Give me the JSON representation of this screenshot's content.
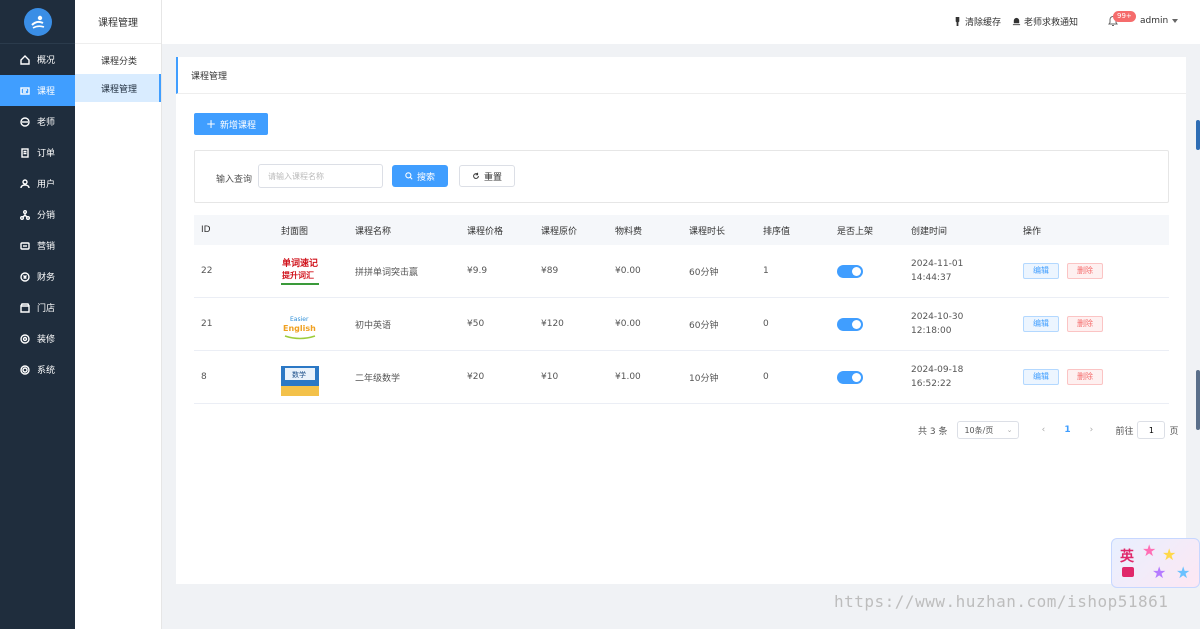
{
  "sidebar": {
    "items": [
      {
        "label": "概况",
        "icon": "home-icon"
      },
      {
        "label": "课程",
        "icon": "course-icon"
      },
      {
        "label": "老师",
        "icon": "teacher-icon"
      },
      {
        "label": "订单",
        "icon": "order-icon"
      },
      {
        "label": "用户",
        "icon": "user-icon"
      },
      {
        "label": "分销",
        "icon": "distribution-icon"
      },
      {
        "label": "营销",
        "icon": "marketing-icon"
      },
      {
        "label": "财务",
        "icon": "finance-icon"
      },
      {
        "label": "门店",
        "icon": "store-icon"
      },
      {
        "label": "装修",
        "icon": "decorate-icon"
      },
      {
        "label": "系统",
        "icon": "settings-icon"
      }
    ],
    "active_index": 1
  },
  "subnav": {
    "title": "课程管理",
    "items": [
      {
        "label": "课程分类"
      },
      {
        "label": "课程管理"
      }
    ]
  },
  "header": {
    "clear_cache": "清除缓存",
    "teacher_help": "老师求救通知",
    "badge": "99+",
    "user": "admin"
  },
  "main": {
    "title": "课程管理",
    "add_button": "新增课程",
    "search": {
      "label": "输入查询",
      "placeholder": "请输入课程名称",
      "search_button": "搜索",
      "reset_button": "重置"
    },
    "table": {
      "columns": [
        "ID",
        "封面图",
        "课程名称",
        "课程价格",
        "课程原价",
        "物料费",
        "课程时长",
        "排序值",
        "是否上架",
        "创建时间",
        "操作"
      ],
      "rows": [
        {
          "id": "22",
          "name": "拼拼单词突击赢",
          "price": "¥9.9",
          "original": "¥89",
          "material": "¥0.00",
          "duration": "60分钟",
          "sort": "1",
          "listed": true,
          "date": "2024-11-01",
          "time": "14:44:37",
          "edit": "编辑",
          "delete": "删除",
          "cover_text_1": "单词速记",
          "cover_text_2": "提升词汇"
        },
        {
          "id": "21",
          "name": "初中英语",
          "price": "¥50",
          "original": "¥120",
          "material": "¥0.00",
          "duration": "60分钟",
          "sort": "0",
          "listed": true,
          "date": "2024-10-30",
          "time": "12:18:00",
          "edit": "编辑",
          "delete": "删除",
          "cover_text_1": "Easier",
          "cover_text_2": "English"
        },
        {
          "id": "8",
          "name": "二年级数学",
          "price": "¥20",
          "original": "¥10",
          "material": "¥1.00",
          "duration": "10分钟",
          "sort": "0",
          "listed": true,
          "date": "2024-09-18",
          "time": "16:52:22",
          "edit": "编辑",
          "delete": "删除",
          "cover_text_1": "数学",
          "cover_text_2": ""
        }
      ]
    },
    "pagination": {
      "total": "共 3 条",
      "page_size": "10条/页",
      "current": "1",
      "goto_label": "前往",
      "goto_value": "1",
      "page_suffix": "页"
    }
  },
  "watermark": "https://www.huzhan.com/ishop51861",
  "widget_char": "英",
  "colors": {
    "sidebar": "#1f2d3d",
    "accent": "#409eff",
    "danger": "#f56c6c"
  }
}
